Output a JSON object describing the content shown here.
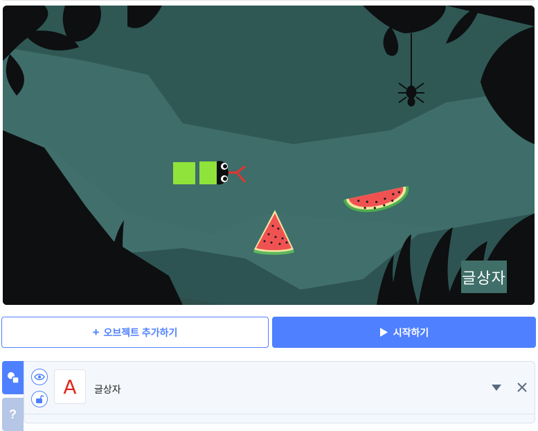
{
  "stage": {
    "text_object_display": "글상자"
  },
  "buttons": {
    "add_object_label": "오브젝트 추가하기",
    "start_label": "시작하기"
  },
  "side_tabs": {
    "help_label": "?"
  },
  "object_list": {
    "items": [
      {
        "name": "글상자",
        "thumb_letter": "A",
        "thumb_color": "#e1261c"
      }
    ]
  },
  "colors": {
    "accent": "#4f80ff",
    "stage_bg": "#2f5854",
    "snake_green": "#8fe33a"
  }
}
